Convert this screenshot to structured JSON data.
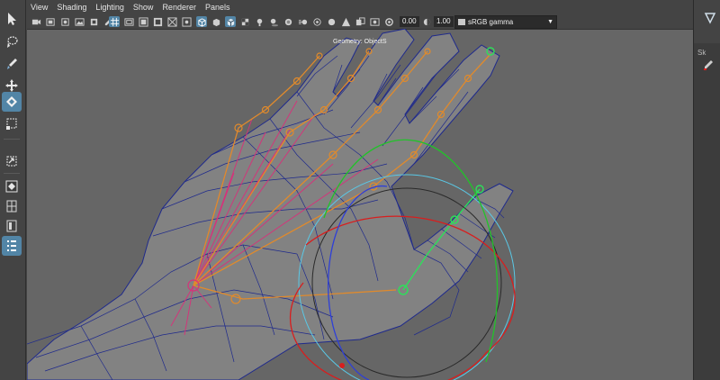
{
  "menu": {
    "items": [
      "View",
      "Shading",
      "Lighting",
      "Show",
      "Renderer",
      "Panels"
    ]
  },
  "toolbar": {
    "exposure_value": "0.00",
    "gamma_value": "1.00",
    "color_space": "sRGB gamma"
  },
  "viewport": {
    "hud_object_label": "Geometry: ObjectS"
  },
  "right_panel": {
    "tab_label": "Sk"
  },
  "tools": [
    "select-tool",
    "lasso-tool",
    "paint-select-tool",
    "move-tool",
    "rotate-tool",
    "scale-tool",
    "soft-select-tool",
    "snap-tool",
    "single-pane-layout",
    "two-pane-layout",
    "four-pane-layout",
    "outliner-layout"
  ],
  "colors": {
    "accent": "#5285a6",
    "mesh_wire": "#1f2a8c",
    "joint": "#e08a2c",
    "influence": "#d8307a",
    "selected_joint": "#2de05a",
    "manip_x": "#d81e1e",
    "manip_y": "#22c22a",
    "manip_z": "#2e3fd8",
    "manip_outer": "#5ac8e6"
  }
}
